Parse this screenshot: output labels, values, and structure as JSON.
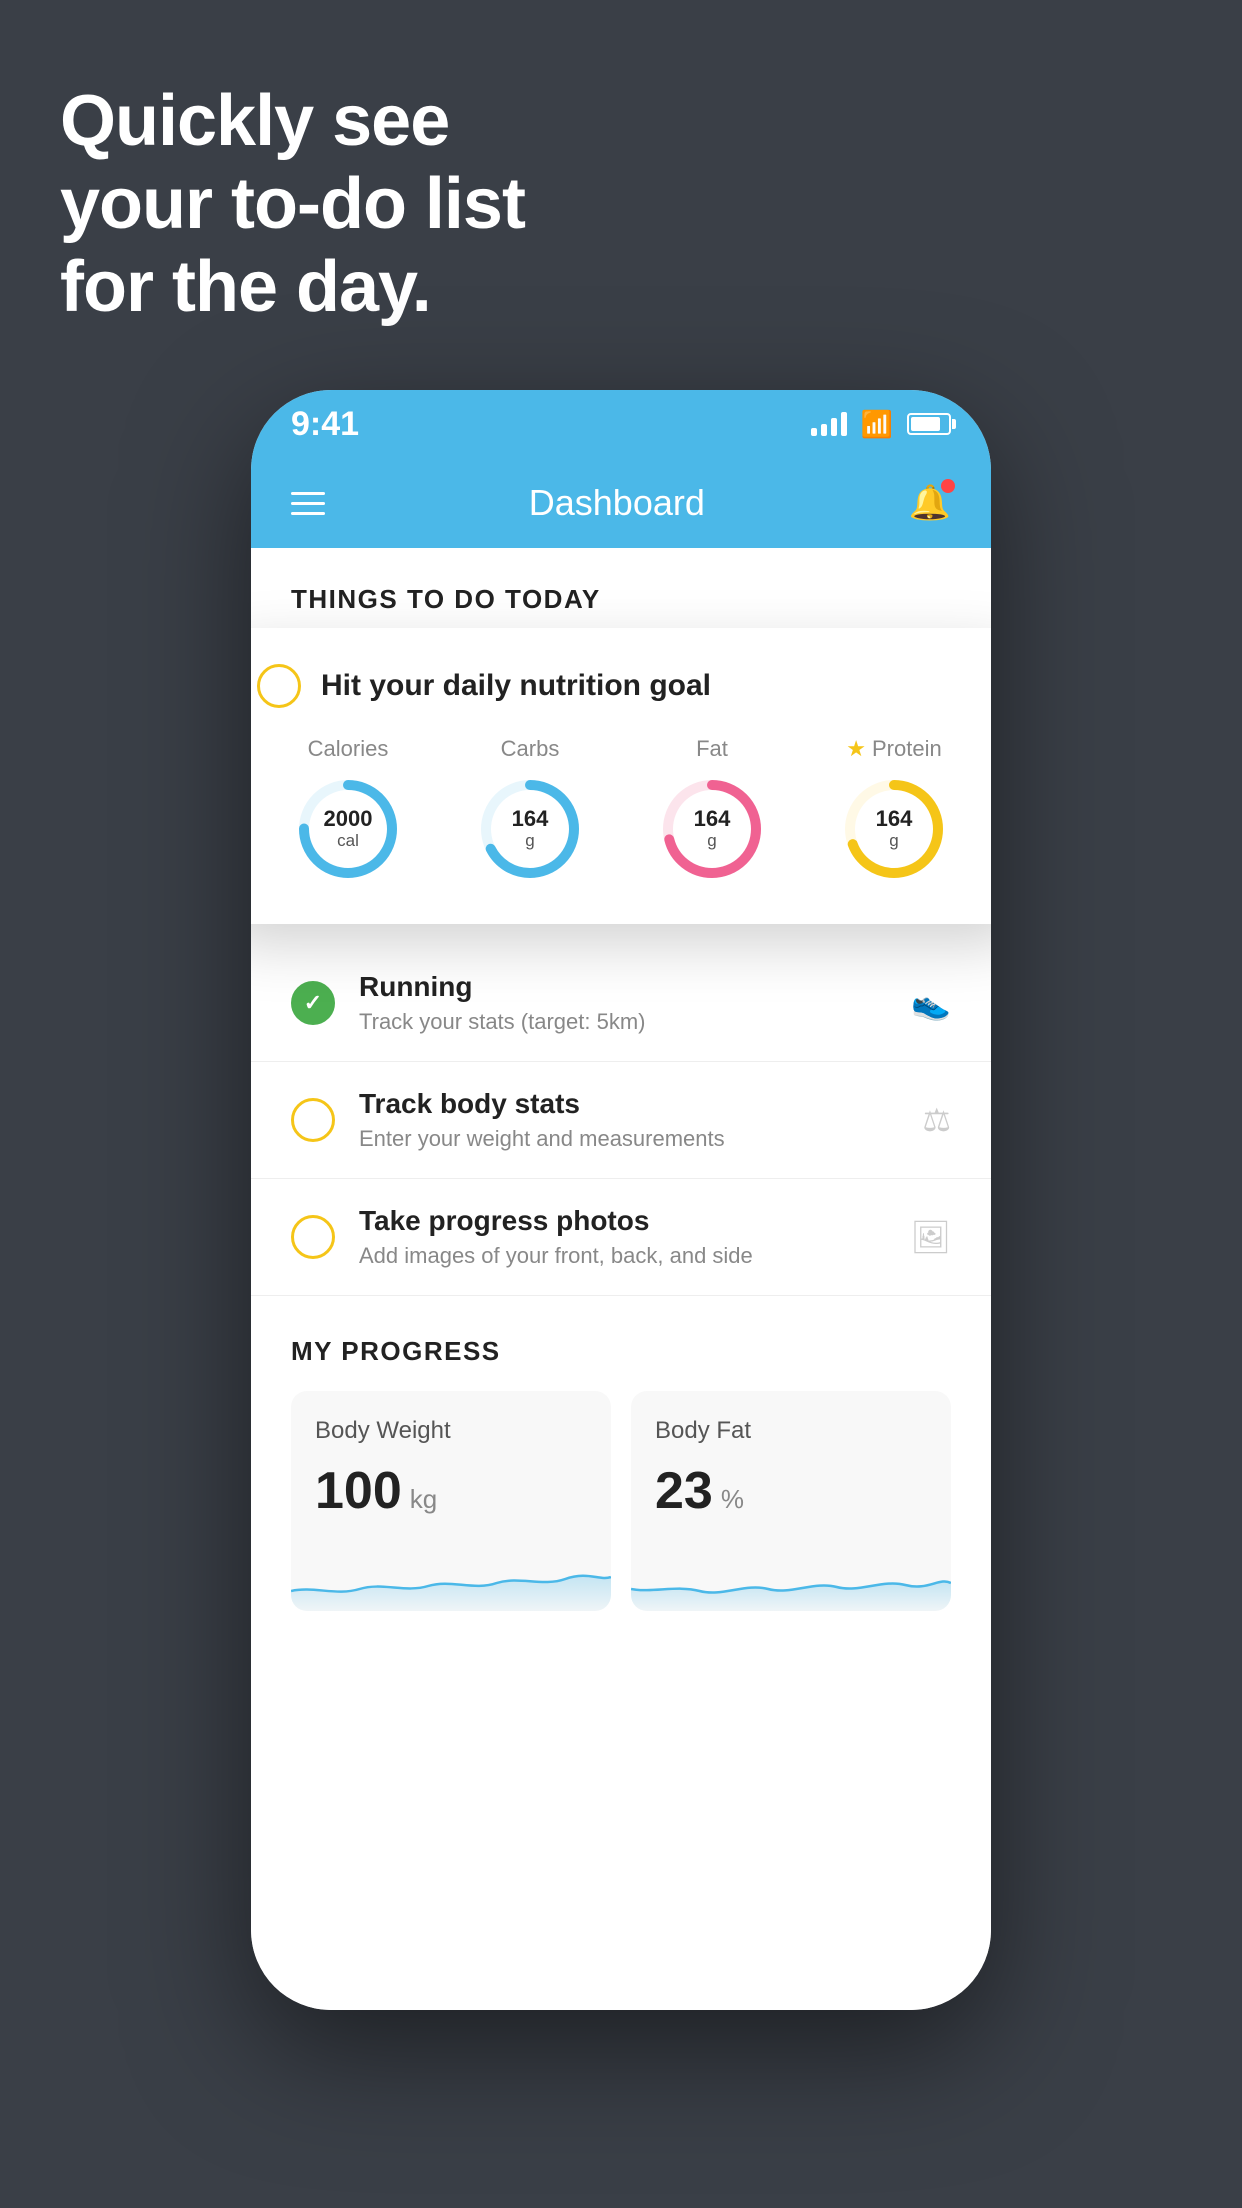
{
  "background": {
    "color": "#3a3f47"
  },
  "headline": {
    "line1": "Quickly see",
    "line2": "your to-do list",
    "line3": "for the day."
  },
  "phone": {
    "status_bar": {
      "time": "9:41"
    },
    "nav_bar": {
      "title": "Dashboard"
    },
    "things_today": {
      "section_title": "THINGS TO DO TODAY",
      "floating_card": {
        "title": "Hit your daily nutrition goal",
        "nutrition": [
          {
            "label": "Calories",
            "value": "2000",
            "unit": "cal",
            "color": "#4bb8e8",
            "track_color": "#e8f6fc",
            "is_star": false
          },
          {
            "label": "Carbs",
            "value": "164",
            "unit": "g",
            "color": "#4bb8e8",
            "track_color": "#e8f6fc",
            "is_star": false
          },
          {
            "label": "Fat",
            "value": "164",
            "unit": "g",
            "color": "#f06292",
            "track_color": "#fce4ec",
            "is_star": false
          },
          {
            "label": "Protein",
            "value": "164",
            "unit": "g",
            "color": "#f5c518",
            "track_color": "#fff9e6",
            "is_star": true
          }
        ]
      },
      "list_items": [
        {
          "title": "Running",
          "subtitle": "Track your stats (target: 5km)",
          "icon": "👟",
          "radio_state": "complete",
          "radio_color": "#4caf50"
        },
        {
          "title": "Track body stats",
          "subtitle": "Enter your weight and measurements",
          "icon": "⚖",
          "radio_state": "incomplete",
          "radio_color": "#f5c518"
        },
        {
          "title": "Take progress photos",
          "subtitle": "Add images of your front, back, and side",
          "icon": "🖼",
          "radio_state": "incomplete",
          "radio_color": "#f5c518"
        }
      ]
    },
    "progress": {
      "section_title": "MY PROGRESS",
      "cards": [
        {
          "title": "Body Weight",
          "value": "100",
          "unit": "kg"
        },
        {
          "title": "Body Fat",
          "value": "23",
          "unit": "%"
        }
      ]
    }
  }
}
